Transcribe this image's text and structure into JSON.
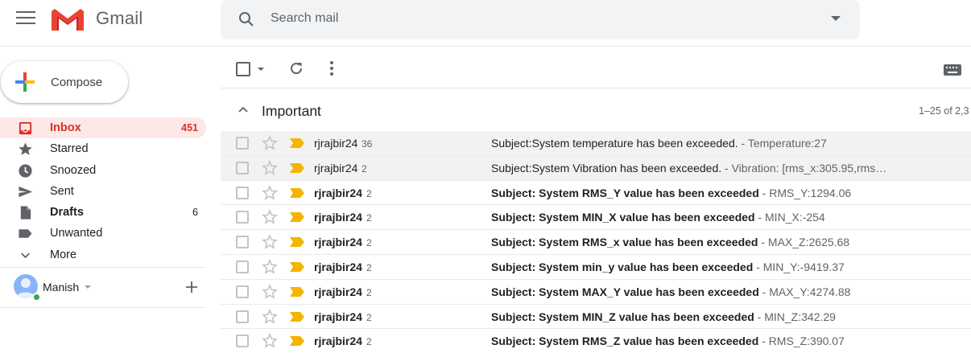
{
  "header": {
    "brand": "Gmail",
    "search_placeholder": "Search mail"
  },
  "sidebar": {
    "compose_label": "Compose",
    "items": [
      {
        "label": "Inbox",
        "count": "451",
        "icon": "inbox-icon",
        "active": true,
        "bold": true
      },
      {
        "label": "Starred",
        "count": "",
        "icon": "star-icon",
        "active": false,
        "bold": false
      },
      {
        "label": "Snoozed",
        "count": "",
        "icon": "clock-icon",
        "active": false,
        "bold": false
      },
      {
        "label": "Sent",
        "count": "",
        "icon": "send-icon",
        "active": false,
        "bold": false
      },
      {
        "label": "Drafts",
        "count": "6",
        "icon": "draft-icon",
        "active": false,
        "bold": true
      },
      {
        "label": "Unwanted",
        "count": "",
        "icon": "label-icon",
        "active": false,
        "bold": false
      },
      {
        "label": "More",
        "count": "",
        "icon": "chevron-down-icon",
        "active": false,
        "bold": false
      }
    ],
    "user_name": "Manish"
  },
  "section": {
    "title": "Important",
    "range": "1–25 of 2,3"
  },
  "colors": {
    "important_marker": "#f4b400",
    "inbox_active": "#d93025"
  },
  "emails": [
    {
      "sender": "rjrajbir24",
      "count": "36",
      "subject": "Subject:System temperature has been exceeded.",
      "snippet": " - Temperature:27",
      "unread": false
    },
    {
      "sender": "rjrajbir24",
      "count": "2",
      "subject": "Subject:System Vibration has been exceeded.",
      "snippet": " - Vibration: [rms_x:305.95,rms…",
      "unread": false
    },
    {
      "sender": "rjrajbir24",
      "count": "2",
      "subject": "Subject: System RMS_Y value has been exceeded",
      "snippet": " - RMS_Y:1294.06",
      "unread": true
    },
    {
      "sender": "rjrajbir24",
      "count": "2",
      "subject": "Subject: System MIN_X value has been exceeded",
      "snippet": " - MIN_X:-254",
      "unread": true
    },
    {
      "sender": "rjrajbir24",
      "count": "2",
      "subject": "Subject: System RMS_x value has been exceeded",
      "snippet": " - MAX_Z:2625.68",
      "unread": true
    },
    {
      "sender": "rjrajbir24",
      "count": "2",
      "subject": "Subject: System min_y value has been exceeded",
      "snippet": " - MIN_Y:-9419.37",
      "unread": true
    },
    {
      "sender": "rjrajbir24",
      "count": "2",
      "subject": "Subject: System MAX_Y value has been exceeded",
      "snippet": " - MAX_Y:4274.88",
      "unread": true
    },
    {
      "sender": "rjrajbir24",
      "count": "2",
      "subject": "Subject: System MIN_Z value has been exceeded",
      "snippet": " - MIN_Z:342.29",
      "unread": true
    },
    {
      "sender": "rjrajbir24",
      "count": "2",
      "subject": "Subject: System RMS_Z value has been exceeded",
      "snippet": " - RMS_Z:390.07",
      "unread": true
    }
  ]
}
